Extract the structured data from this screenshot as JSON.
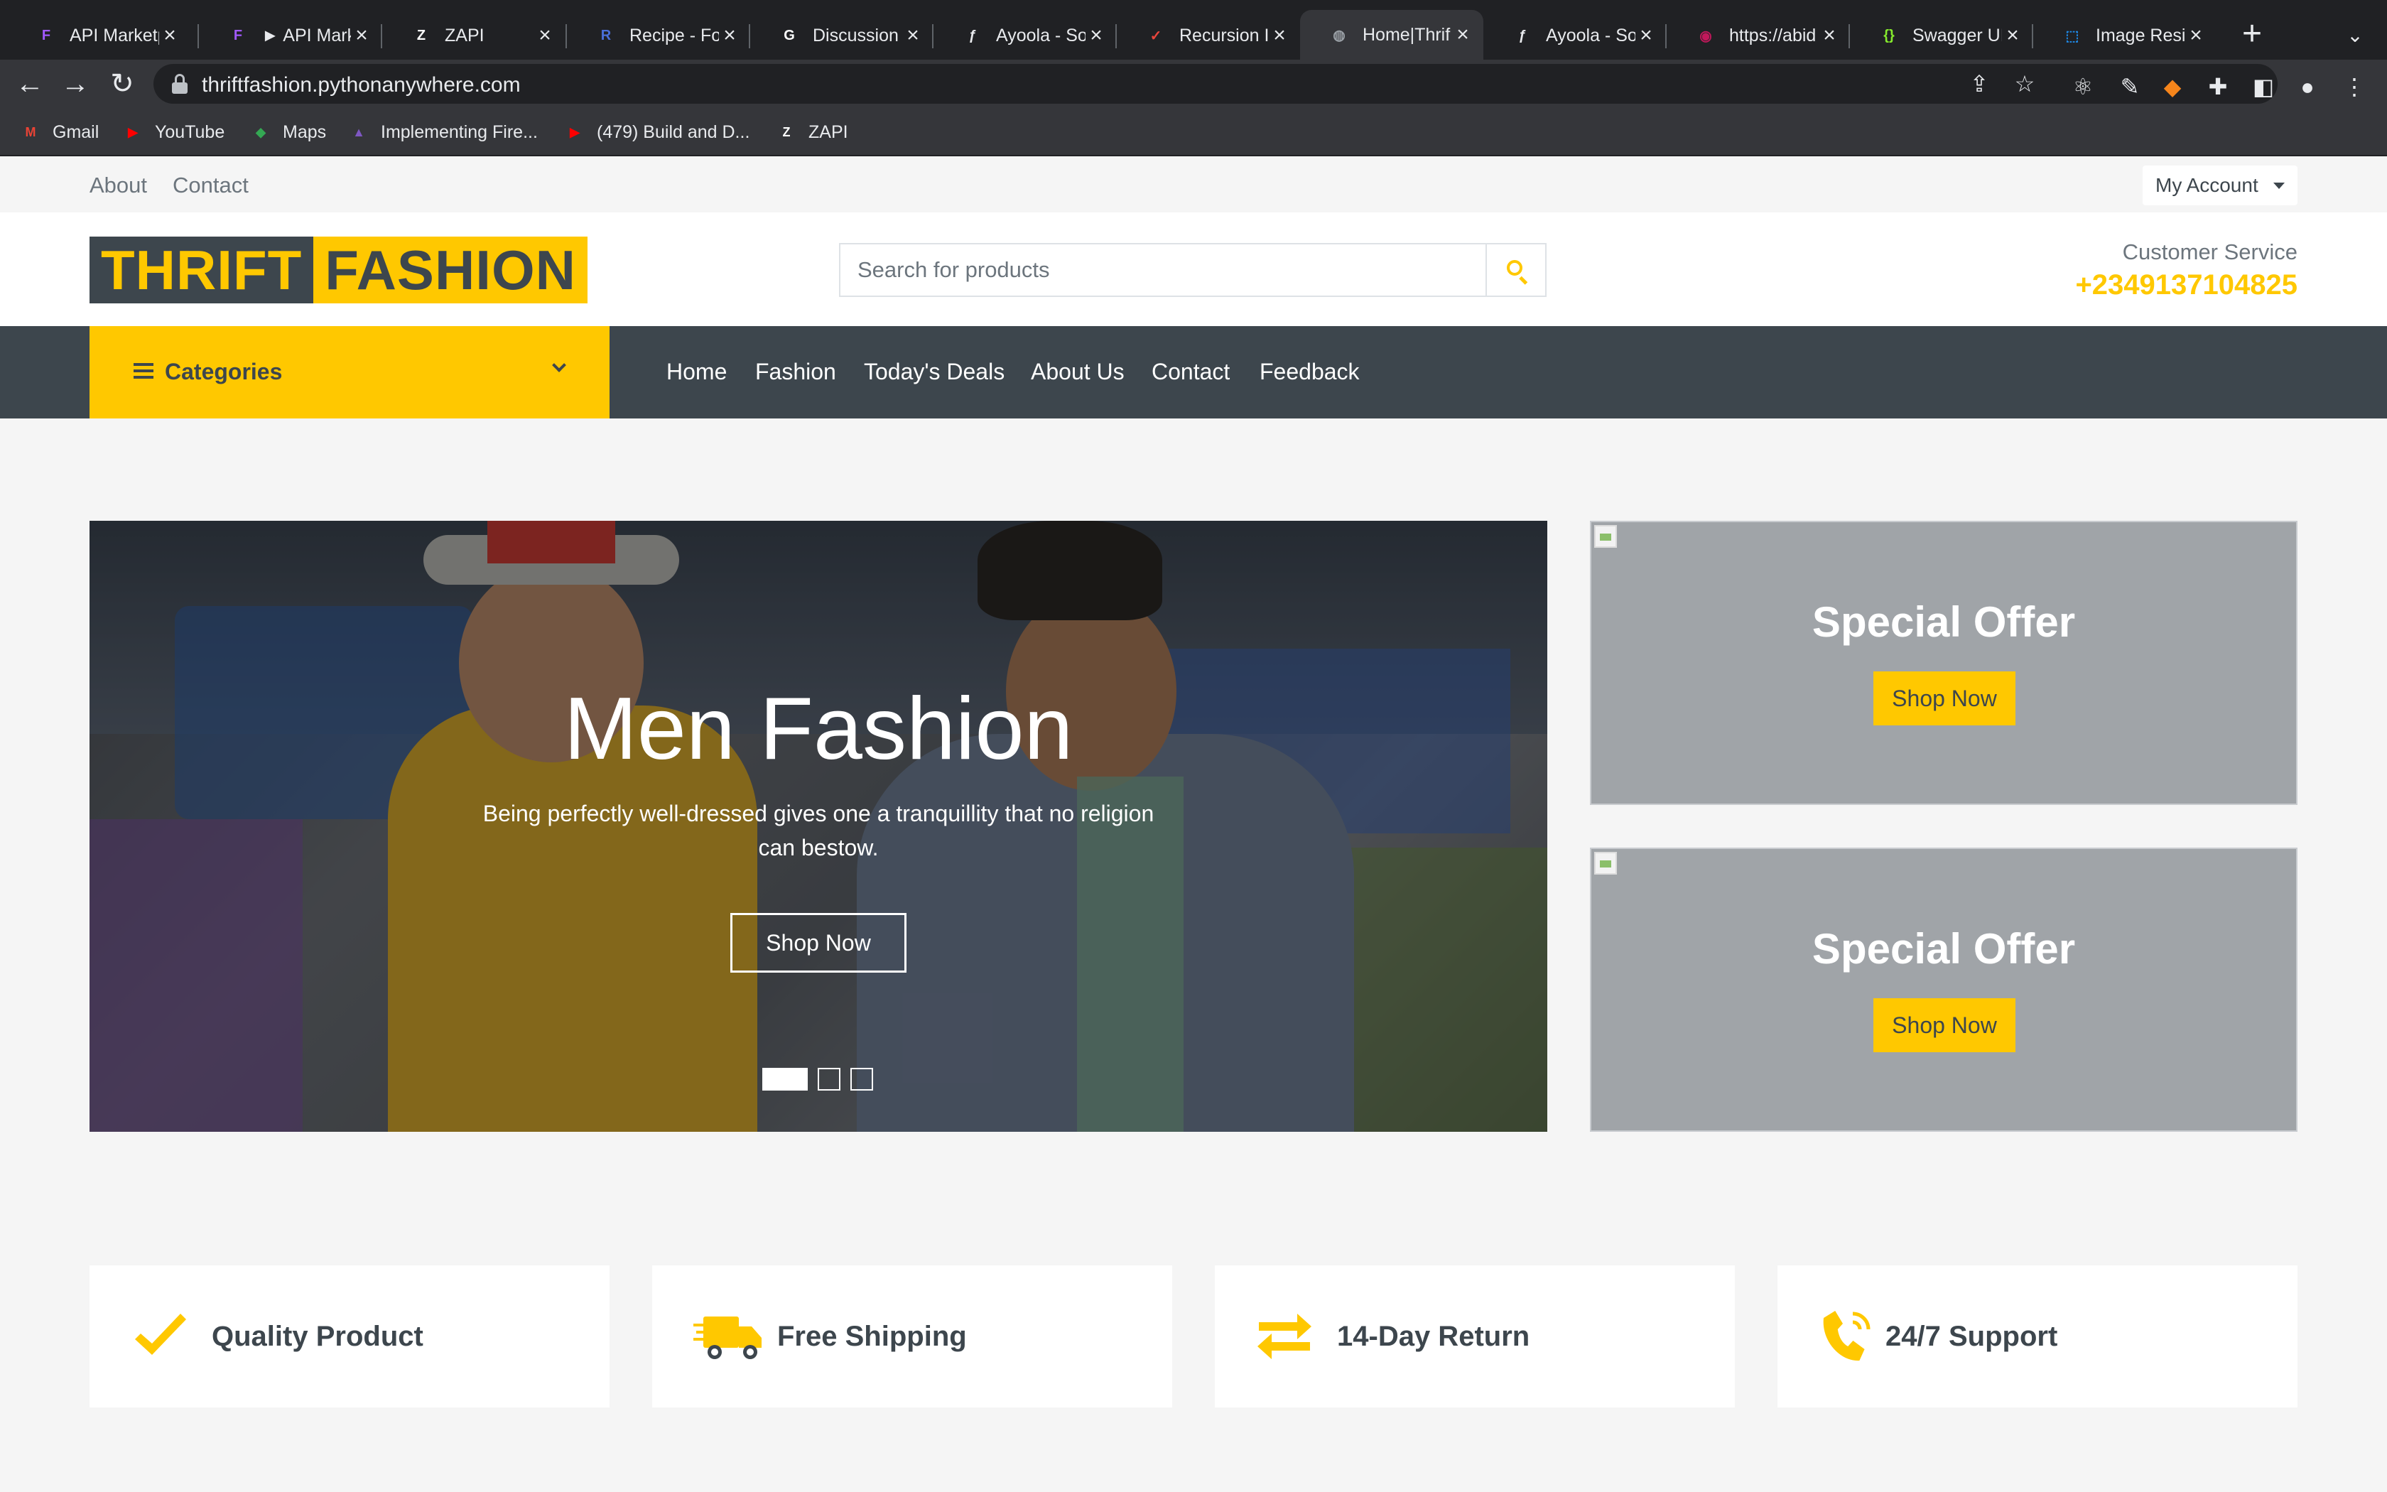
{
  "browser": {
    "tabs": [
      {
        "title": "API Marketp",
        "fav_color": "#a259ff",
        "fav_glyph": "F",
        "active": false
      },
      {
        "title": "► API Mark",
        "fav_color": "#a259ff",
        "fav_glyph": "F",
        "active": false
      },
      {
        "title": "ZAPI",
        "fav_color": "#ffffff",
        "fav_glyph": "Z",
        "active": false
      },
      {
        "title": "Recipe - Fo",
        "fav_color": "#4a6fd8",
        "fav_glyph": "R",
        "active": false
      },
      {
        "title": "Discussion",
        "fav_color": "#ffffff",
        "fav_glyph": "G",
        "active": false
      },
      {
        "title": "Ayoola - So",
        "fav_color": "#e8eaed",
        "fav_glyph": "ƒ",
        "active": false
      },
      {
        "title": "Recursion I",
        "fav_color": "#e8453c",
        "fav_glyph": "✓",
        "active": false
      },
      {
        "title": "Home|Thrif",
        "fav_color": "#9aa0a6",
        "fav_glyph": "◍",
        "active": true
      },
      {
        "title": "Ayoola - So",
        "fav_color": "#e8eaed",
        "fav_glyph": "ƒ",
        "active": false
      },
      {
        "title": "https://abid",
        "fav_color": "#c2185b",
        "fav_glyph": "◉",
        "active": false
      },
      {
        "title": "Swagger UI",
        "fav_color": "#85ea2d",
        "fav_glyph": "{}",
        "active": false
      },
      {
        "title": "Image Resi",
        "fav_color": "#1e88e5",
        "fav_glyph": "⬚",
        "active": false
      }
    ],
    "url": "thriftfashion.pythonanywhere.com",
    "bookmarks": [
      {
        "label": "Gmail",
        "fav_color": "#ea4335",
        "fav_glyph": "M"
      },
      {
        "label": "YouTube",
        "fav_color": "#ff0000",
        "fav_glyph": "▶"
      },
      {
        "label": "Maps",
        "fav_color": "#34a853",
        "fav_glyph": "◆"
      },
      {
        "label": "Implementing Fire...",
        "fav_color": "#7e57c2",
        "fav_glyph": "▲"
      },
      {
        "label": "(479) Build and D...",
        "fav_color": "#ff0000",
        "fav_glyph": "▶"
      },
      {
        "label": "ZAPI",
        "fav_color": "#ffffff",
        "fav_glyph": "Z"
      }
    ]
  },
  "topbar": {
    "links": [
      "About",
      "Contact"
    ],
    "account_label": "My Account"
  },
  "header": {
    "logo_part1": "THRIFT",
    "logo_part2": "FASHION",
    "search_placeholder": "Search for products",
    "cs_label": "Customer Service",
    "cs_phone": "+2349137104825"
  },
  "nav": {
    "categories_label": "Categories",
    "links": [
      "Home",
      "Fashion",
      "Today's Deals",
      "About Us",
      "Contact",
      "Feedback"
    ]
  },
  "hero": {
    "title": "Men Fashion",
    "subtitle": "Being perfectly well-dressed gives one a tranquillity that no religion can bestow.",
    "button": "Shop Now",
    "slide_count": 3,
    "active_slide": 1
  },
  "offers": [
    {
      "title": "Special Offer",
      "button": "Shop Now"
    },
    {
      "title": "Special Offer",
      "button": "Shop Now"
    }
  ],
  "features": [
    {
      "label": "Quality Product",
      "icon": "check-icon"
    },
    {
      "label": "Free Shipping",
      "icon": "shipping-truck-icon"
    },
    {
      "label": "14-Day Return",
      "icon": "exchange-arrows-icon"
    },
    {
      "label": "24/7 Support",
      "icon": "phone-volume-icon"
    }
  ],
  "colors": {
    "accent": "#ffc800",
    "dark": "#3d464d",
    "text_muted": "#6c757d",
    "page_bg": "#f5f5f5"
  }
}
